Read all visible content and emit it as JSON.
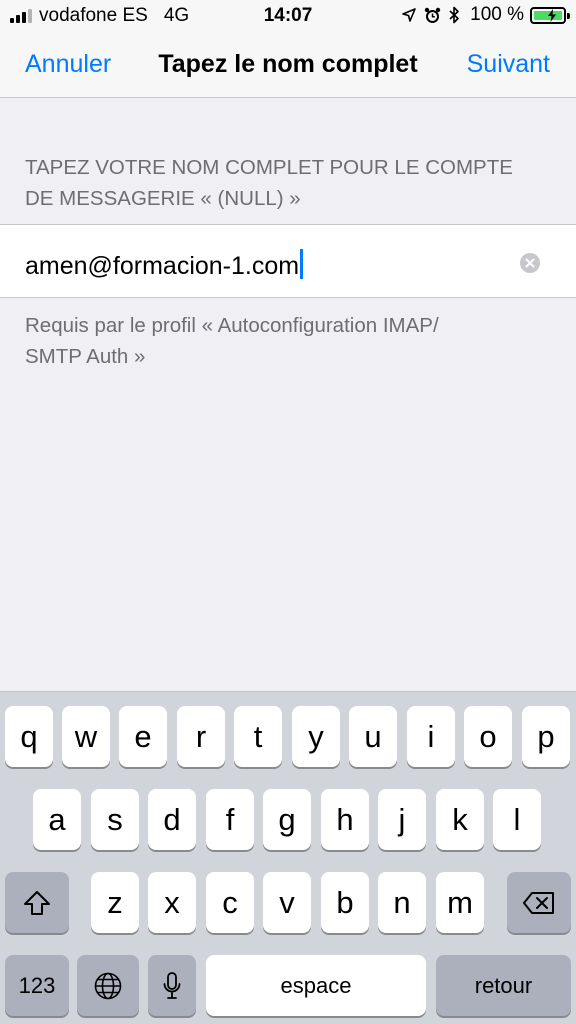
{
  "status_bar": {
    "carrier": "vodafone ES",
    "network": "4G",
    "time": "14:07",
    "battery_percent": "100 %",
    "battery_level": 1.0,
    "battery_color": "#4cd964"
  },
  "nav": {
    "cancel_label": "Annuler",
    "title": "Tapez le nom complet",
    "next_label": "Suivant",
    "accent_color": "#007aff"
  },
  "form": {
    "header_line1": "TAPEZ VOTRE NOM COMPLET POUR LE COMPTE",
    "header_line2": "DE MESSAGERIE « (NULL) »",
    "field_value": "amen@formacion-1.com",
    "footer_line1": "Requis par le profil « Autoconfiguration IMAP/",
    "footer_line2": "SMTP Auth »"
  },
  "keyboard": {
    "row1": [
      "q",
      "w",
      "e",
      "r",
      "t",
      "y",
      "u",
      "i",
      "o",
      "p"
    ],
    "row2": [
      "a",
      "s",
      "d",
      "f",
      "g",
      "h",
      "j",
      "k",
      "l"
    ],
    "row3": [
      "z",
      "x",
      "c",
      "v",
      "b",
      "n",
      "m"
    ],
    "numbers_label": "123",
    "space_label": "espace",
    "return_label": "retour",
    "icons": {
      "shift": "shift-icon",
      "delete": "delete-icon",
      "globe": "globe-icon",
      "mic": "microphone-icon"
    }
  }
}
